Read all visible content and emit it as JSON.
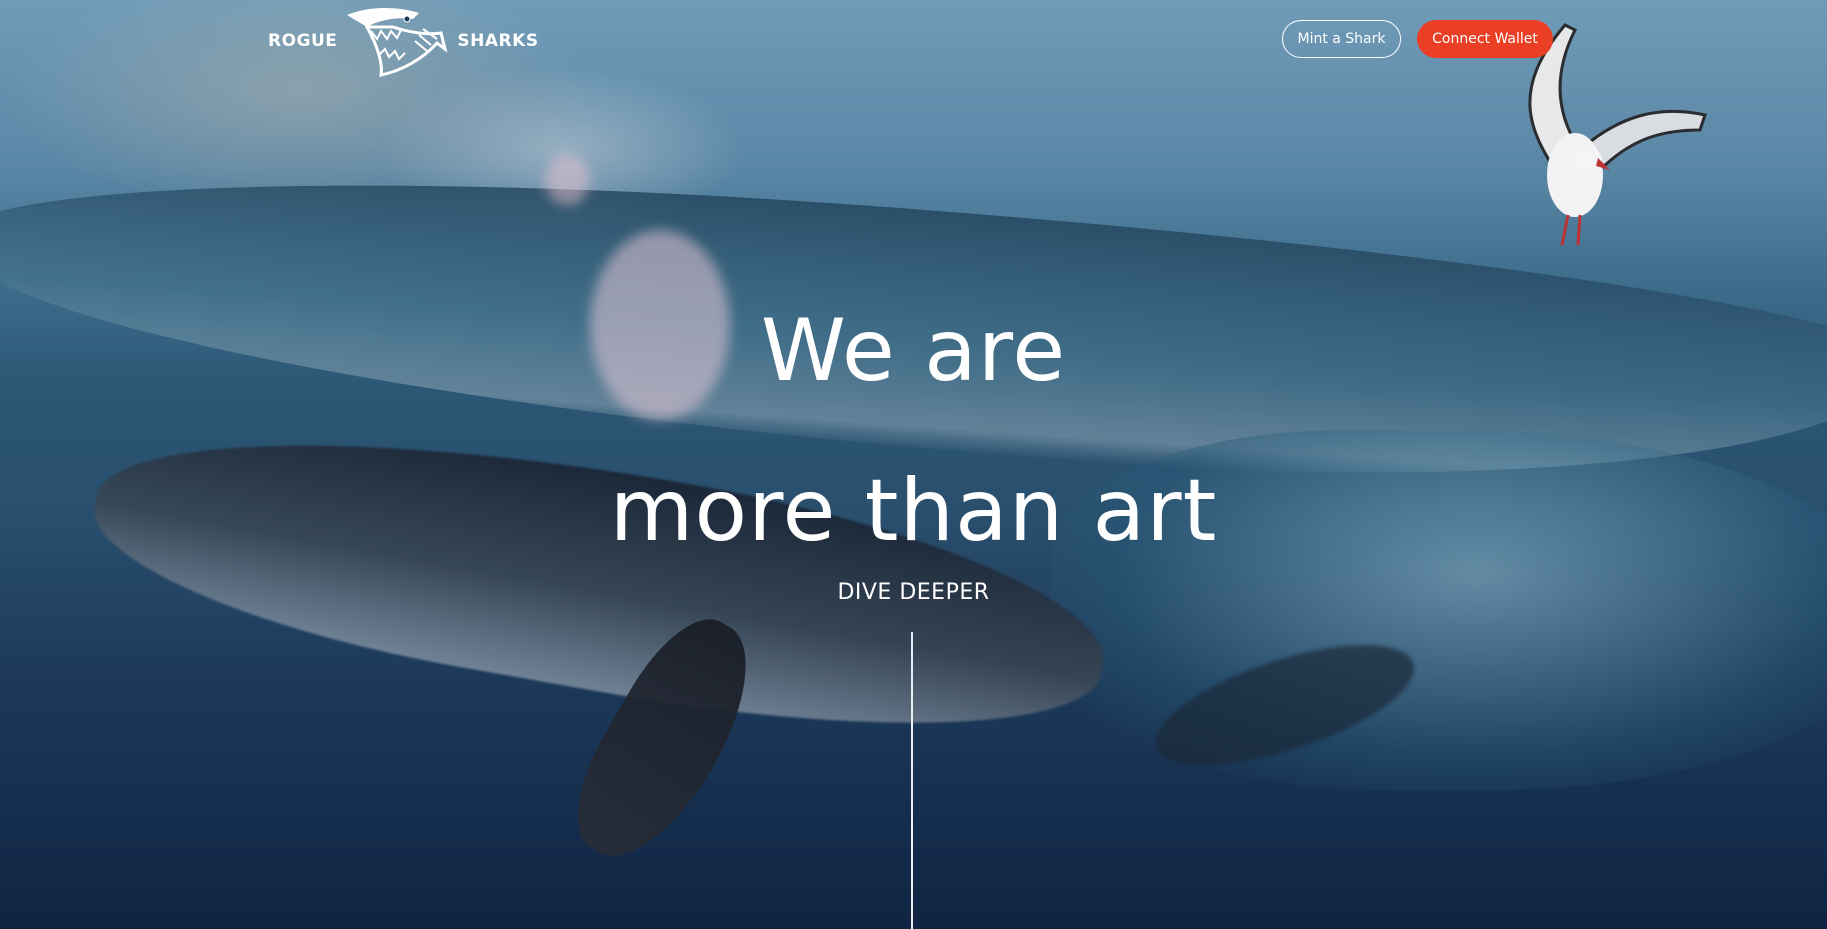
{
  "header": {
    "logo_left": "ROGUE",
    "logo_right": "SHARKS",
    "mint_label": "Mint a Shark",
    "connect_label": "Connect Wallet"
  },
  "hero": {
    "line1": "We are",
    "line2": "more than art",
    "cta": "DIVE DEEPER"
  },
  "colors": {
    "accent": "#ea3f25",
    "text": "#ffffff"
  },
  "icons": {
    "logo": "shark-head-icon",
    "scroll": "scroll-line"
  }
}
